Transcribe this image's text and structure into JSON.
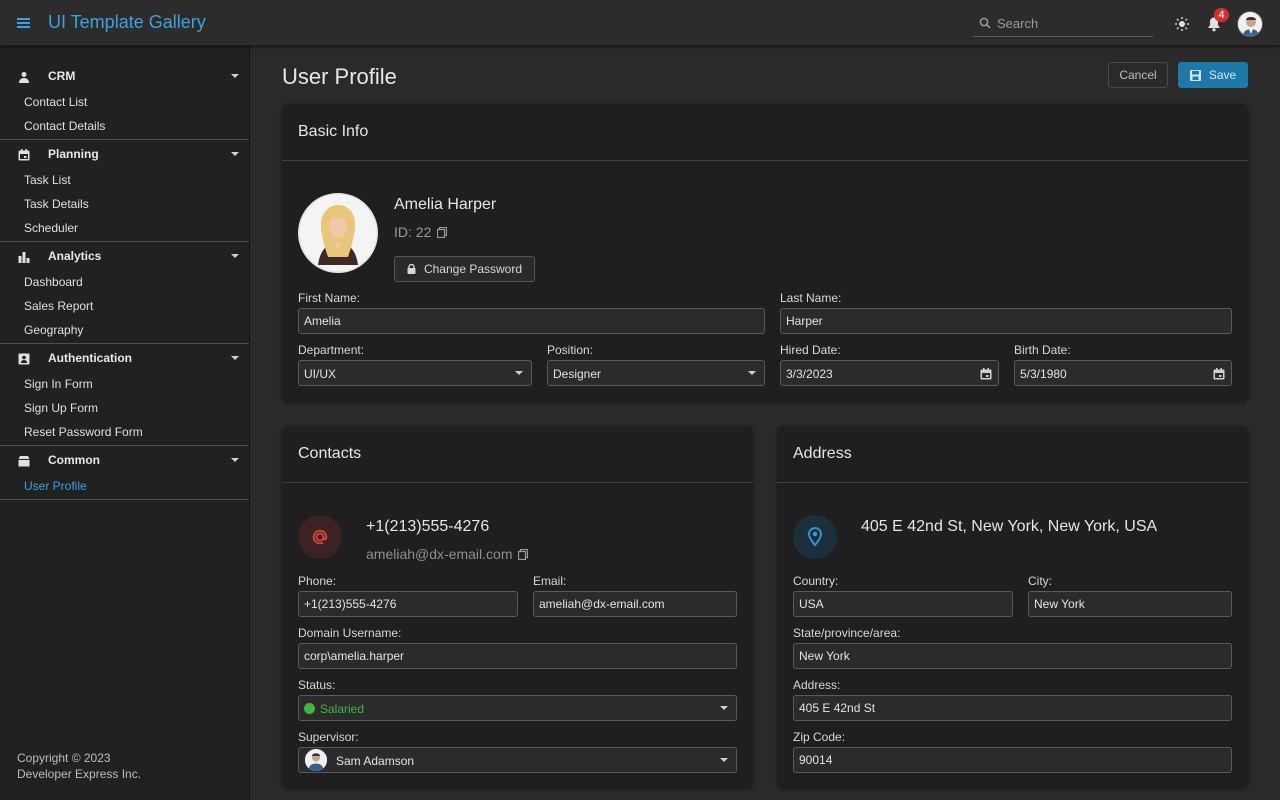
{
  "header": {
    "title": "UI Template Gallery",
    "search_placeholder": "Search",
    "notification_count": "4"
  },
  "sidebar": {
    "groups": [
      {
        "label": "CRM",
        "icon": "person-icon",
        "items": [
          {
            "label": "Contact List"
          },
          {
            "label": "Contact Details"
          }
        ]
      },
      {
        "label": "Planning",
        "icon": "calendar-icon",
        "items": [
          {
            "label": "Task List"
          },
          {
            "label": "Task Details"
          },
          {
            "label": "Scheduler"
          }
        ]
      },
      {
        "label": "Analytics",
        "icon": "chart-icon",
        "items": [
          {
            "label": "Dashboard"
          },
          {
            "label": "Sales Report"
          },
          {
            "label": "Geography"
          }
        ]
      },
      {
        "label": "Authentication",
        "icon": "badge-icon",
        "items": [
          {
            "label": "Sign In Form"
          },
          {
            "label": "Sign Up Form"
          },
          {
            "label": "Reset Password Form"
          }
        ]
      },
      {
        "label": "Common",
        "icon": "box-icon",
        "items": [
          {
            "label": "User Profile",
            "active": true
          }
        ]
      }
    ],
    "footer_line1": "Copyright © 2023",
    "footer_line2": "Developer Express Inc."
  },
  "page": {
    "title": "User Profile",
    "cancel_label": "Cancel",
    "save_label": "Save"
  },
  "basic_info": {
    "title": "Basic Info",
    "name": "Amelia Harper",
    "id_text": "ID: 22",
    "change_password_label": "Change Password",
    "first_name_label": "First Name:",
    "first_name": "Amelia",
    "last_name_label": "Last Name:",
    "last_name": "Harper",
    "department_label": "Department:",
    "department": "UI/UX",
    "position_label": "Position:",
    "position": "Designer",
    "hired_date_label": "Hired Date:",
    "hired_date": "3/3/2023",
    "birth_date_label": "Birth Date:",
    "birth_date": "5/3/1980"
  },
  "contacts": {
    "title": "Contacts",
    "phone_display": "+1(213)555-4276",
    "email_display": "ameliah@dx-email.com",
    "phone_label": "Phone:",
    "phone": "+1(213)555-4276",
    "email_label": "Email:",
    "email": "ameliah@dx-email.com",
    "domain_label": "Domain Username:",
    "domain": "corp\\amelia.harper",
    "status_label": "Status:",
    "status": "Salaried",
    "status_color": "#3fb43f",
    "supervisor_label": "Supervisor:",
    "supervisor": "Sam Adamson"
  },
  "address": {
    "title": "Address",
    "full_address": "405 E 42nd St, New York, New York, USA",
    "country_label": "Country:",
    "country": "USA",
    "city_label": "City:",
    "city": "New York",
    "state_label": "State/province/area:",
    "state": "New York",
    "address_label": "Address:",
    "address": "405 E 42nd St",
    "zip_label": "Zip Code:",
    "zip": "90014"
  },
  "colors": {
    "accent": "#3aa3e0",
    "save_button": "#1e79a8",
    "contacts_icon": "#e0453b",
    "address_icon": "#2f9fe0",
    "badge": "#d32f2f"
  }
}
